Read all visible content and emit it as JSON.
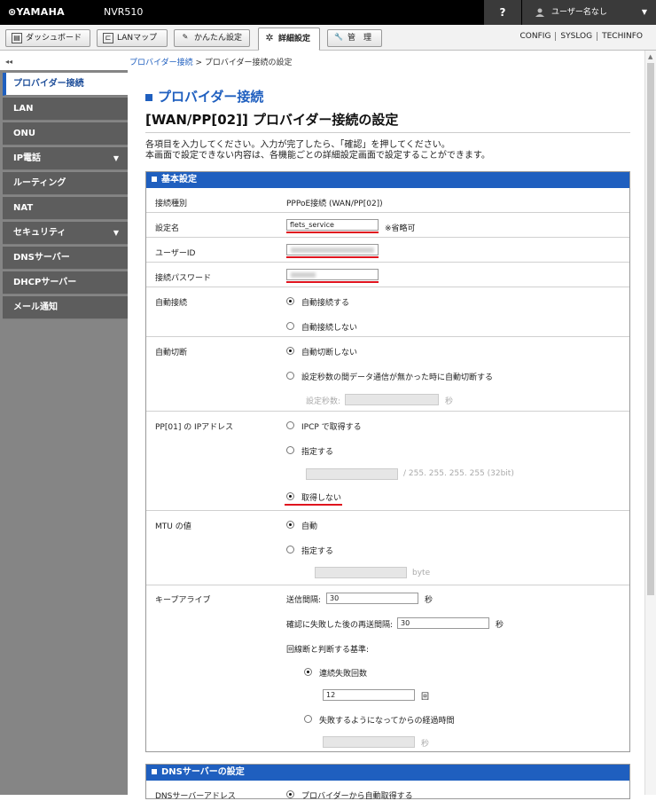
{
  "topbar": {
    "brand": "⊛YAMAHA",
    "model": "NVR510",
    "help": "?",
    "user": "ユーザー名なし",
    "user_dropdown": "▼"
  },
  "tabs": [
    {
      "label": "ダッシュボード",
      "icon": "dashboard-icon"
    },
    {
      "label": "LANマップ",
      "icon": "lanmap-icon"
    },
    {
      "label": "かんたん設定",
      "icon": "wand-icon"
    },
    {
      "label": "詳細設定",
      "icon": "gear-icon"
    },
    {
      "label": "管　理",
      "icon": "wrench-icon"
    }
  ],
  "right_links": [
    "CONFIG",
    "SYSLOG",
    "TECHINFO"
  ],
  "sidebar": {
    "collapse": "◂◂",
    "items": [
      {
        "label": "プロバイダー接続",
        "expand": ""
      },
      {
        "label": "LAN",
        "expand": ""
      },
      {
        "label": "ONU",
        "expand": ""
      },
      {
        "label": "IP電話",
        "expand": "▼"
      },
      {
        "label": "ルーティング",
        "expand": ""
      },
      {
        "label": "NAT",
        "expand": ""
      },
      {
        "label": "セキュリティ",
        "expand": "▼"
      },
      {
        "label": "DNSサーバー",
        "expand": ""
      },
      {
        "label": "DHCPサーバー",
        "expand": ""
      },
      {
        "label": "メール通知",
        "expand": ""
      }
    ]
  },
  "breadcrumb": {
    "link": "プロバイダー接続",
    "sep": " > ",
    "current": "プロバイダー接続の設定"
  },
  "page": {
    "heading": "プロバイダー接続",
    "subheading": "[WAN/PP[02]] プロバイダー接続の設定",
    "desc1": "各項目を入力してください。入力が完了したら、「確認」を押してください。",
    "desc2": "本画面で設定できない内容は、各機能ごとの詳細設定画面で設定することができます。"
  },
  "basic": {
    "title": "基本設定",
    "type_label": "接続種別",
    "type_value": "PPPoE接続 (WAN/PP[02])",
    "name_label": "設定名",
    "name_value": "flets_service",
    "name_note": "※省略可",
    "userid_label": "ユーザーID",
    "password_label": "接続パスワード",
    "autoconnect_label": "自動接続",
    "autoconnect_opt1": "自動接続する",
    "autoconnect_opt2": "自動接続しない",
    "autodisconnect_label": "自動切断",
    "autodisconnect_opt1": "自動切断しない",
    "autodisconnect_opt2": "設定秒数の間データ通信が無かった時に自動切断する",
    "autodisconnect_seconds_label": "設定秒数:",
    "autodisconnect_unit": "秒",
    "ip_label": "PP[01] の IPアドレス",
    "ip_opt1": "IPCP で取得する",
    "ip_opt2": "指定する",
    "ip_mask": "/ 255. 255. 255. 255 (32bit)",
    "ip_opt3": "取得しない",
    "mtu_label": "MTU の値",
    "mtu_opt1": "自動",
    "mtu_opt2": "指定する",
    "mtu_unit": "byte",
    "keepalive_label": "キープアライブ",
    "ka_interval_label": "送信間隔:",
    "ka_interval_value": "30",
    "ka_interval_unit": "秒",
    "ka_retry_label": "確認に失敗した後の再送間隔:",
    "ka_retry_value": "30",
    "ka_retry_unit": "秒",
    "ka_criteria_label": "回線断と判断する基準:",
    "ka_opt1": "連続失敗回数",
    "ka_count_value": "12",
    "ka_count_unit": "回",
    "ka_opt2": "失敗するようになってからの経過時間",
    "ka_time_unit": "秒"
  },
  "dns": {
    "title": "DNSサーバーの設定",
    "row_label": "DNSサーバーアドレス",
    "row_opt": "プロバイダーから自動取得する"
  }
}
